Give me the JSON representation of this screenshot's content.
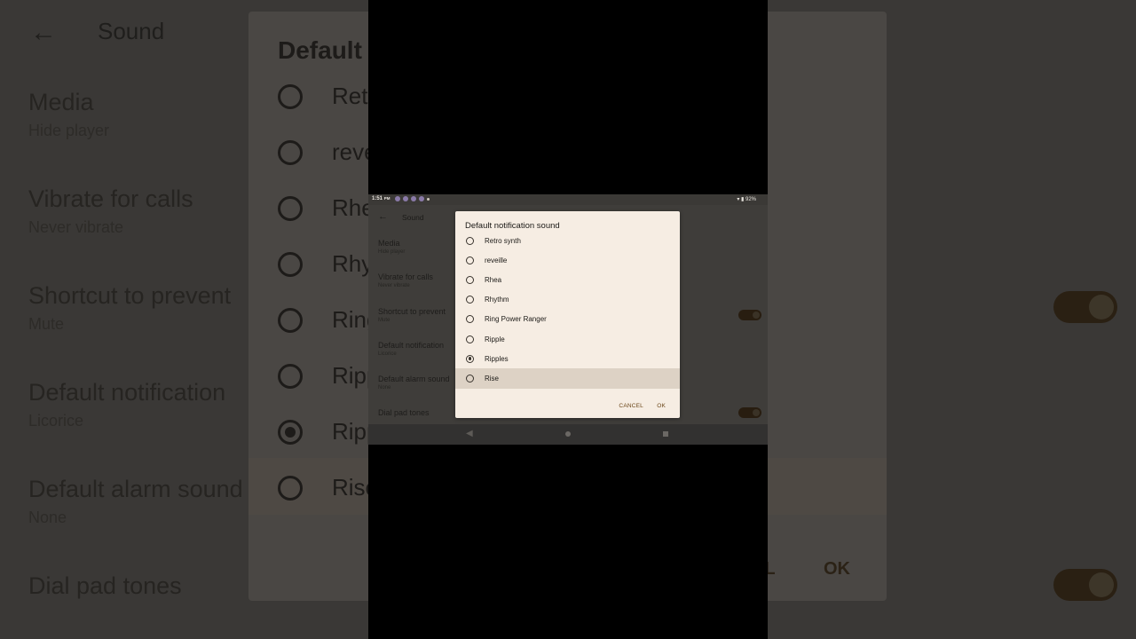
{
  "status_bar": {
    "time": "1:51",
    "time_suffix": "PM",
    "battery": "92%"
  },
  "app_bar": {
    "back_glyph": "←",
    "title": "Sound"
  },
  "settings": [
    {
      "title": "Media",
      "subtitle": "Hide player"
    },
    {
      "title": "Vibrate for calls",
      "subtitle": "Never vibrate"
    },
    {
      "title": "Shortcut to prevent",
      "subtitle": "Mute"
    },
    {
      "title": "Default notification",
      "subtitle": "Licorice"
    },
    {
      "title": "Default alarm sound",
      "subtitle": "None"
    },
    {
      "title": "Dial pad tones",
      "subtitle": ""
    }
  ],
  "background_zoom": {
    "settings": [
      {
        "title": "Media",
        "subtitle": "Hide player"
      },
      {
        "title": "Vibrate for calls",
        "subtitle": "Never vibrate"
      },
      {
        "title": "Shortcut to prevent",
        "subtitle": "Mute"
      },
      {
        "title": "Default notification",
        "subtitle": "Licorice"
      },
      {
        "title": "Default alarm sound",
        "subtitle": "None"
      },
      {
        "title": "Dial pad tones",
        "subtitle": ""
      }
    ],
    "dialog_title": "Default n",
    "items": [
      "Retro",
      "reve",
      "Rhe",
      "Rhy",
      "Ring",
      "Ripp",
      "Ripp",
      "Rise"
    ],
    "cancel_label": "EL",
    "ok_label": "OK"
  },
  "dialog": {
    "title": "Default notification sound",
    "items": [
      {
        "label": "Retro synth",
        "selected": false
      },
      {
        "label": "reveille",
        "selected": false
      },
      {
        "label": "Rhea",
        "selected": false
      },
      {
        "label": "Rhythm",
        "selected": false
      },
      {
        "label": "Ring Power Ranger",
        "selected": false
      },
      {
        "label": "Ripple",
        "selected": false
      },
      {
        "label": "Ripples",
        "selected": true
      },
      {
        "label": "Rise",
        "selected": false,
        "highlighted": true
      }
    ],
    "cancel_label": "CANCEL",
    "ok_label": "OK"
  },
  "nav_bar": {
    "back_glyph": "◀"
  },
  "colors": {
    "dialog_bg": "#f6ede3",
    "accent": "#6a4517",
    "scrim": "#3f3d3a",
    "highlight": "#ddd2c5"
  }
}
